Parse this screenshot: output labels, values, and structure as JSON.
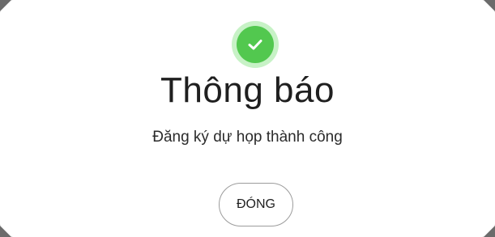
{
  "dialog": {
    "icon": "check-circle-icon",
    "title": "Thông báo",
    "message": "Đăng ký dự họp thành công",
    "close_label": "ĐÓNG"
  },
  "colors": {
    "success": "#52c84f",
    "success_ring": "#c7f2c6",
    "backdrop": "#6b6b6b"
  }
}
